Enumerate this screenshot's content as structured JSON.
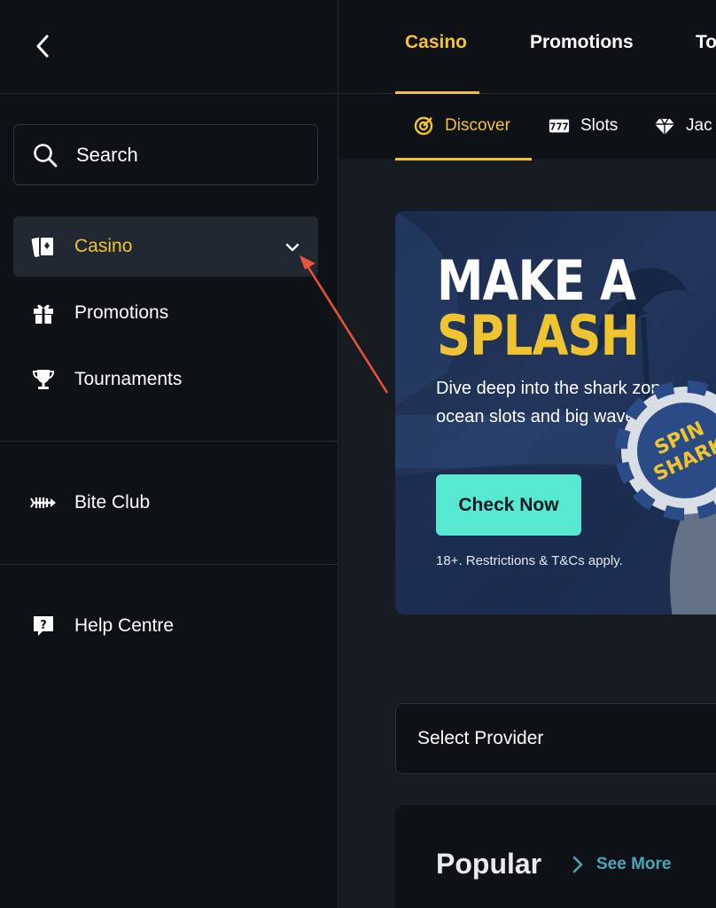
{
  "sidebar": {
    "search_label": "Search",
    "items": [
      {
        "label": "Casino",
        "icon": "casino-cards-icon",
        "active": true
      },
      {
        "label": "Promotions",
        "icon": "gift-icon"
      },
      {
        "label": "Tournaments",
        "icon": "trophy-icon"
      },
      {
        "label": "Bite Club",
        "icon": "fishbone-icon"
      },
      {
        "label": "Help Centre",
        "icon": "help-bubble-icon"
      }
    ]
  },
  "topnav": {
    "tabs": [
      {
        "label": "Casino",
        "active": true
      },
      {
        "label": "Promotions"
      },
      {
        "label": "To"
      }
    ]
  },
  "subnav": {
    "tabs": [
      {
        "label": "Discover",
        "icon": "target-icon",
        "active": true
      },
      {
        "label": "Slots",
        "icon": "slots-icon"
      },
      {
        "label": "Jac",
        "icon": "diamond-icon"
      }
    ]
  },
  "banner": {
    "title_line1": "MAKE A",
    "title_line2": "SPLASH",
    "desc_line1": "Dive deep into the shark zone –",
    "desc_line2": "ocean slots and big waves awa",
    "cta": "Check Now",
    "legal": "18+. Restrictions & T&Cs apply.",
    "chip_text_1": "SPIN",
    "chip_text_2": "SHARK"
  },
  "provider": {
    "label": "Select Provider"
  },
  "popular": {
    "title": "Popular",
    "see_more": "See More"
  },
  "colors": {
    "accent": "#f0c431",
    "cta": "#56e8d1",
    "background": "#0e1116",
    "annotation_arrow": "#e8553a"
  }
}
